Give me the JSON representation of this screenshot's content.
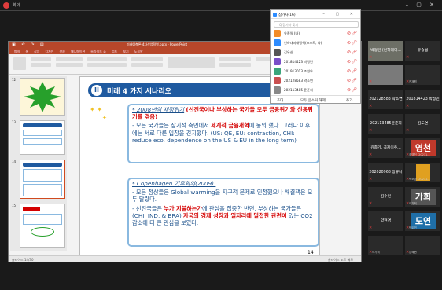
{
  "window": {
    "title": "회의"
  },
  "ppt": {
    "title": "미래예측론-4차산업혁명.pptx - PowerPoint",
    "tabs": [
      "파일",
      "홈",
      "삽입",
      "디자인",
      "전환",
      "애니메이션",
      "슬라이드 쇼",
      "검토",
      "보기",
      "도움말"
    ],
    "thumb_numbers": [
      "12",
      "13",
      "14",
      "15"
    ],
    "page_number": "14",
    "status_left": "슬라이드 14/30",
    "status_right": "슬라이드 노트  메모"
  },
  "slide": {
    "number": "II",
    "title": "미래 4 가지 시나리오",
    "box1": {
      "head": "* 2008년의 재정위기",
      "head_red": "(선진국이나 부상하는 국가들 모두 금융위기와 신용위기를 겪음)",
      "line1a": "- 모든 국가들은 장기적 측면에서 ",
      "line1b": "세계적 금융개혁",
      "line1c": "에 동의 했다. 그러나 이후에는 서로 다른 입장을 견지했다. (US: QE, EU: contraction, CHI: reduce eco. dependence on the US & EU in the long term)"
    },
    "box2": {
      "head": "* Copenhagen 기후회의(2009):",
      "line1": "- 모든 정상들은 Global warming을 지구적 문제로 인정했으나 해결책은 모두 달랐다.",
      "line2a": "- 선진국들은 ",
      "line2b": "누가 지불하는가",
      "line2c": "에 관심을 집중한 반면, 부상하는 국가들은(CHI, IND, & BRA) ",
      "line2d": "자국의 경제 성장과 일자리에 밀접한 관련이",
      "line2e": " 있는 CO2 감소에 더 큰 관심을 보였다."
    }
  },
  "participants": {
    "title": "참가자(16)",
    "search_placeholder": "Q 참가자 찾기",
    "rows": [
      {
        "name": "유종일 (나)",
        "color": "#f28c28"
      },
      {
        "name": "인하대미래정책(호스트, 나)",
        "color": "#2d8cff"
      },
      {
        "name": "김유신",
        "color": "#555555"
      },
      {
        "name": "201814423 박정민",
        "color": "#7a4fc9"
      },
      {
        "name": "201913013 조원우",
        "color": "#3aa57a"
      },
      {
        "name": "202128583 곽소연",
        "color": "#c94f4f"
      },
      {
        "name": "202113485 윤준희",
        "color": "#888888"
      }
    ],
    "footer": {
      "invite": "초대",
      "unmute_all": "모두 음소거 해제",
      "more": "추가"
    }
  },
  "tiles": [
    {
      "id": "vid1",
      "label": "박정원 (인하대미...",
      "sub": ""
    },
    {
      "id": "t2",
      "label": "유승범",
      "sub": ""
    },
    {
      "id": "vid2",
      "label": "",
      "sub": ""
    },
    {
      "id": "t4",
      "label": "",
      "sub": "전재원"
    },
    {
      "id": "t5",
      "label": "202128583 곽소연",
      "sub": ""
    },
    {
      "id": "t6",
      "label": "201814423 박정민",
      "sub": ""
    },
    {
      "id": "t7",
      "label": "202113485윤준희",
      "sub": ""
    },
    {
      "id": "t8",
      "label": "김도연",
      "sub": ""
    },
    {
      "id": "t9",
      "label": "김종기, 국제이주...",
      "sub": ""
    },
    {
      "id": "t10",
      "label": "",
      "sub": "최영천 (20211...",
      "big": "영천",
      "bigcolor": "#c0392b"
    },
    {
      "id": "t11",
      "label": "202020968 장규나",
      "sub": ""
    },
    {
      "id": "t12",
      "label": "",
      "sub": "박소영 (20211...",
      "bigcolor": "#e0a020"
    },
    {
      "id": "t13",
      "label": "김수민",
      "sub": ""
    },
    {
      "id": "t14",
      "label": "",
      "sub": "이가희",
      "big": "가희",
      "bigcolor": "#555555"
    },
    {
      "id": "t15",
      "label": "양현경",
      "sub": ""
    },
    {
      "id": "t16",
      "label": "",
      "sub": "박도연",
      "big": "도연",
      "bigcolor": "#1f6fa8"
    },
    {
      "id": "t17",
      "label": "",
      "sub": "이가희"
    },
    {
      "id": "t18",
      "label": "",
      "sub": "김혜현"
    }
  ]
}
